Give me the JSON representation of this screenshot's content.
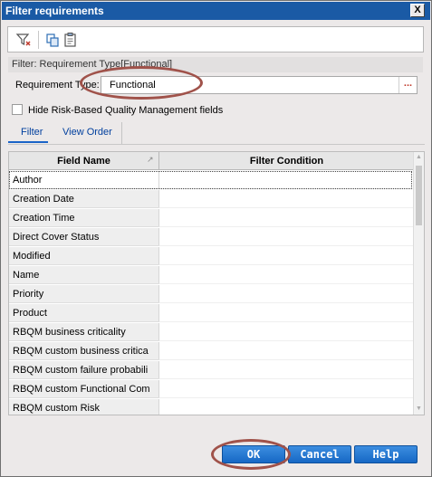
{
  "window": {
    "title": "Filter requirements",
    "close_glyph": "X"
  },
  "toolbar": {
    "icons": [
      "filter-icon",
      "copy-icon",
      "clipboard-icon"
    ]
  },
  "filter_summary": "Filter: Requirement Type[Functional]",
  "requirement_type": {
    "label": "Requirement Type:",
    "value": "Functional",
    "browse_glyph": "..."
  },
  "hide_rbqm": {
    "label": "Hide Risk-Based Quality Management fields",
    "checked": false
  },
  "tabs": [
    {
      "label": "Filter",
      "active": true
    },
    {
      "label": "View Order",
      "active": false
    }
  ],
  "grid": {
    "columns": [
      "Field Name",
      "Filter Condition"
    ],
    "rows": [
      {
        "field": "Author",
        "condition": ""
      },
      {
        "field": "Creation Date",
        "condition": ""
      },
      {
        "field": "Creation Time",
        "condition": ""
      },
      {
        "field": "Direct Cover Status",
        "condition": ""
      },
      {
        "field": "Modified",
        "condition": ""
      },
      {
        "field": "Name",
        "condition": ""
      },
      {
        "field": "Priority",
        "condition": ""
      },
      {
        "field": "Product",
        "condition": ""
      },
      {
        "field": "RBQM business criticality",
        "condition": ""
      },
      {
        "field": "RBQM custom business critica",
        "condition": ""
      },
      {
        "field": "RBQM custom failure probabili",
        "condition": ""
      },
      {
        "field": "RBQM custom Functional Com",
        "condition": ""
      },
      {
        "field": "RBQM custom Risk",
        "condition": ""
      }
    ]
  },
  "buttons": {
    "ok": "OK",
    "cancel": "Cancel",
    "help": "Help"
  },
  "colors": {
    "titlebar": "#1a5aa5",
    "button": "#1b6ccb",
    "highlight": "#a0524a"
  }
}
